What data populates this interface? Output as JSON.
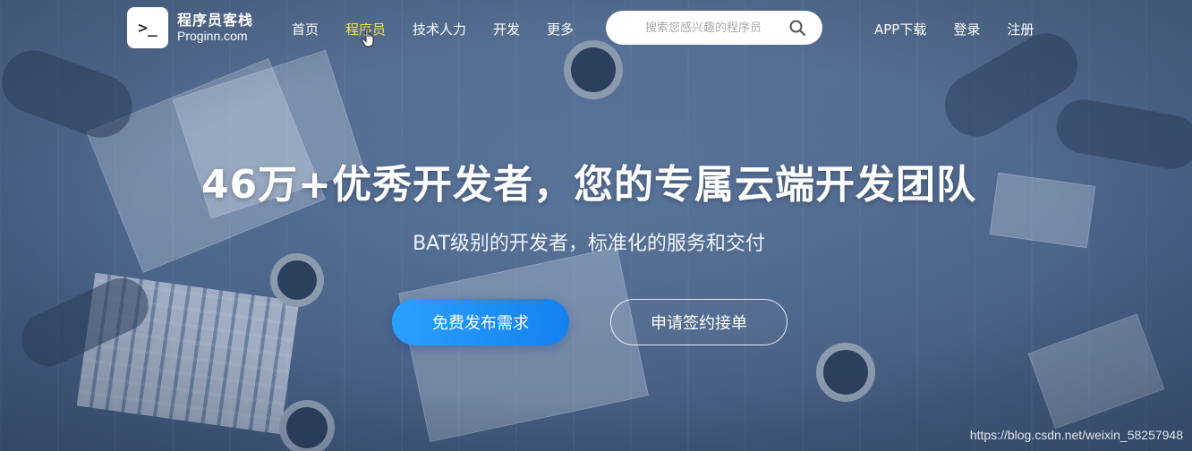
{
  "logo": {
    "mark": ">_",
    "name": "程序员客栈",
    "domain": "Proginn.com"
  },
  "nav": {
    "items": [
      "首页",
      "程序员",
      "技术人力",
      "开发",
      "更多"
    ],
    "active_index": 1
  },
  "search": {
    "placeholder": "搜索您感兴趣的程序员",
    "icon": "search-icon"
  },
  "header_right": {
    "links": [
      "APP下载",
      "登录",
      "注册"
    ]
  },
  "hero": {
    "title": "46万+优秀开发者，您的专属云端开发团队",
    "subtitle": "BAT级别的开发者，标准化的服务和交付",
    "primary_button": "免费发布需求",
    "secondary_button": "申请签约接单"
  },
  "watermark": "https://blog.csdn.net/weixin_58257948",
  "colors": {
    "active_nav": "#f5e44a",
    "primary_button": "#1a8cf5",
    "overlay": "#4a6285"
  }
}
